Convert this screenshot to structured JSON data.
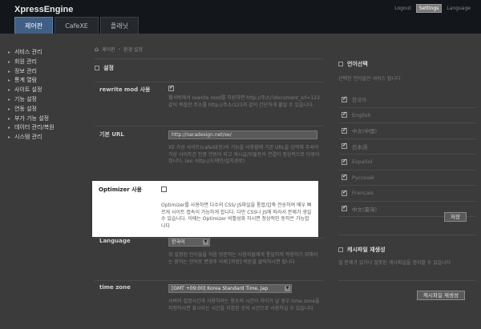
{
  "header": {
    "brand": "XpressEngine",
    "links": {
      "logout": "Logout",
      "settings": "Settings",
      "language": "Language"
    },
    "tabs": [
      "제어판",
      "CafeXE",
      "플래닛"
    ]
  },
  "nav": [
    "서비스 관리",
    "회원 관리",
    "정보 관리",
    "통계 열람",
    "사이트 설정",
    "기능 설정",
    "연동 설정",
    "부가 기능 설정",
    "데이터 관리/복원",
    "시스템 관리"
  ],
  "breadcrumb": {
    "home": "⌂",
    "items": [
      "제어판",
      "›",
      "환경 설정"
    ]
  },
  "main": {
    "section_title": "설정",
    "rewrite": {
      "label": "rewrite mod 사용",
      "checked": true,
      "desc": "웹서버에서 rewrite mod를 지원하면 http://주소/?document_srl=123같이 복잡한 주소를 http://주소/123과 같이 간단하게 줄일 수 있습니다."
    },
    "default_url": {
      "label": "기본 URL",
      "value": "http://naradesign.net/xe/",
      "desc": "XE 가상 사이트(cafeXE등)의 기능을 사용할때 기본 URL을 입력해 주셔야 가상 사이트간 인증 연동이 되고 게시글/모듈등의 연결이 정상적으로 이루어집니다. (ex: http://도메인/설치경로)"
    },
    "optimizer": {
      "label": "Optimizer 사용",
      "checked": false,
      "desc": "Optimizer를 사용하면 다수의 CSS/ JS파일을 통합/압축 전송하여 매우 빠르게 사이트 접속이 가능하게 합니다. 다만 CSS나 JS에 따라서 문제가 생길 수 있습니다. 이때는 Optimizer 비활성화 하시면 정상적인 동작은 가능합니다"
    },
    "language": {
      "label": "Language",
      "value": "한국어",
      "desc": "위 설정된 언어들을 처음 방문하는 사용자들에게 통일하게 적용하기 위해서는 원하는 언어로 변경후 아래 [저장] 버튼을 클릭하시면 됩니다"
    },
    "timezone": {
      "label": "time zone",
      "value": "[GMT +09:00] Korea Standard Time, Jap",
      "desc": "서버의 설정시간과 사용하려는 장소의 시간이 차이가 날 경우 time zone을 지정하시면 표시되는 시간을 지정된 곳의 시간으로 사용하실 수 있습니다"
    }
  },
  "right": {
    "lang_title": "언어선택",
    "lang_desc": "선택된 언어들만 서비스 됩니다",
    "languages": [
      {
        "name": "한국어",
        "checked": true
      },
      {
        "name": "English",
        "checked": true
      },
      {
        "name": "中文(中国)",
        "checked": true
      },
      {
        "name": "日本語",
        "checked": true
      },
      {
        "name": "Español",
        "checked": true
      },
      {
        "name": "Русский",
        "checked": true
      },
      {
        "name": "Français",
        "checked": true
      },
      {
        "name": "中文(臺灣)",
        "checked": true
      }
    ],
    "save_label": "저장",
    "cache_title": "캐시파일 재생성",
    "cache_desc": "설 문제가 있거나 잘못된 캐시파일을 정리할 수 있습니다",
    "cache_button": "캐시파일 재생성"
  }
}
